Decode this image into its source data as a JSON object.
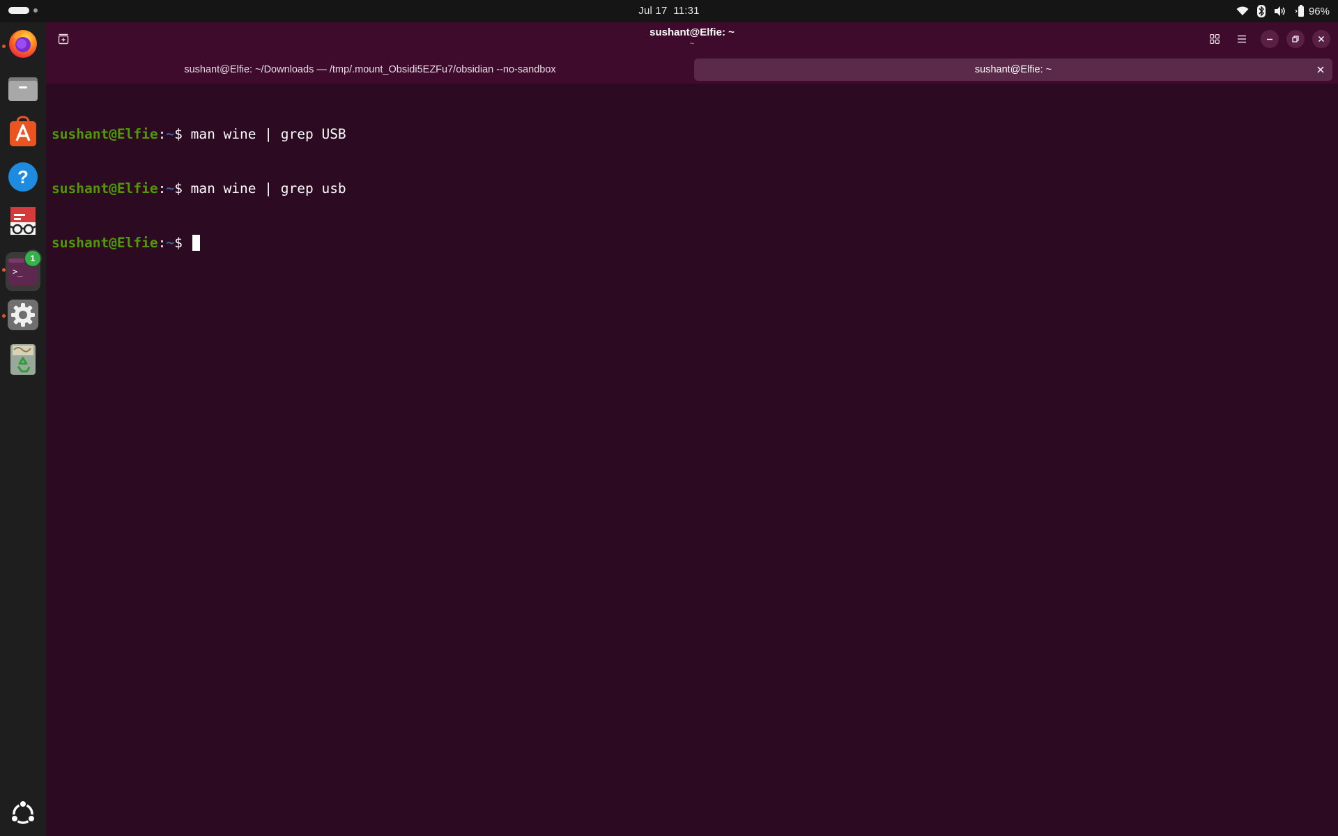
{
  "topbar": {
    "date": "Jul 17",
    "time": "11:31",
    "battery": "96%"
  },
  "window": {
    "title": "sushant@Elfie: ~",
    "subtitle": "~"
  },
  "tabs": [
    {
      "label": "sushant@Elfie: ~/Downloads — /tmp/.mount_Obsidi5EZFu7/obsidian --no-sandbox",
      "active": false
    },
    {
      "label": "sushant@Elfie: ~",
      "active": true
    }
  ],
  "terminal": {
    "lines": [
      {
        "user_host": "sushant@Elfie",
        "sep": ":",
        "path": "~",
        "prompt": "$ ",
        "command": "man wine | grep USB"
      },
      {
        "user_host": "sushant@Elfie",
        "sep": ":",
        "path": "~",
        "prompt": "$ ",
        "command": "man wine | grep usb"
      },
      {
        "user_host": "sushant@Elfie",
        "sep": ":",
        "path": "~",
        "prompt": "$ ",
        "command": ""
      }
    ]
  },
  "dock": {
    "items": [
      {
        "name": "firefox-icon",
        "running": true
      },
      {
        "name": "files-icon",
        "running": false
      },
      {
        "name": "app-center-icon",
        "running": false
      },
      {
        "name": "help-icon",
        "running": false
      },
      {
        "name": "document-viewer-icon",
        "running": false
      },
      {
        "name": "terminal-icon",
        "running": true,
        "badge": "1"
      },
      {
        "name": "settings-icon",
        "running": true
      },
      {
        "name": "trash-icon",
        "running": false
      },
      {
        "name": "show-apps-icon",
        "running": false
      }
    ]
  },
  "colors": {
    "terminal_bg": "#2c0a22",
    "headerbar_bg": "#3e0b2c",
    "prompt_user": "#4e9a06",
    "prompt_path": "#3465a4",
    "accent": "#e95420"
  }
}
